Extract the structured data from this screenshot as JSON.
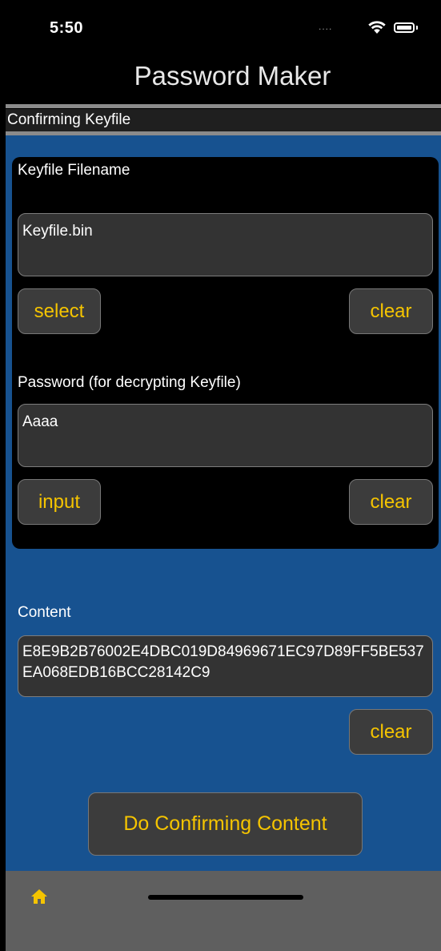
{
  "status_bar": {
    "time": "5:50",
    "signal": "....",
    "wifi_icon": "wifi-icon",
    "battery_icon": "battery-icon"
  },
  "nav": {
    "title": "Password Maker",
    "subtitle": "Confirming Keyfile"
  },
  "keyfile": {
    "label": "Keyfile Filename",
    "value": "Keyfile.bin",
    "select_label": "select",
    "clear_label": "clear"
  },
  "password": {
    "label": "Password (for decrypting Keyfile)",
    "value": "Aaaa",
    "input_label": "input",
    "clear_label": "clear"
  },
  "content": {
    "label": "Content",
    "value": "E8E9B2B76002E4DBC019D84969671EC97D89FF5BE537EA068EDB16BCC28142C9",
    "clear_label": "clear"
  },
  "actions": {
    "confirm_label": "Do Confirming Content"
  },
  "tab_bar": {
    "home_icon": "home-icon"
  },
  "colors": {
    "background": "#175290",
    "card": "#000000",
    "field": "#333333",
    "button": "#3c3c3c",
    "accent": "#f5c400",
    "tab_bar": "#5f5f5f"
  }
}
